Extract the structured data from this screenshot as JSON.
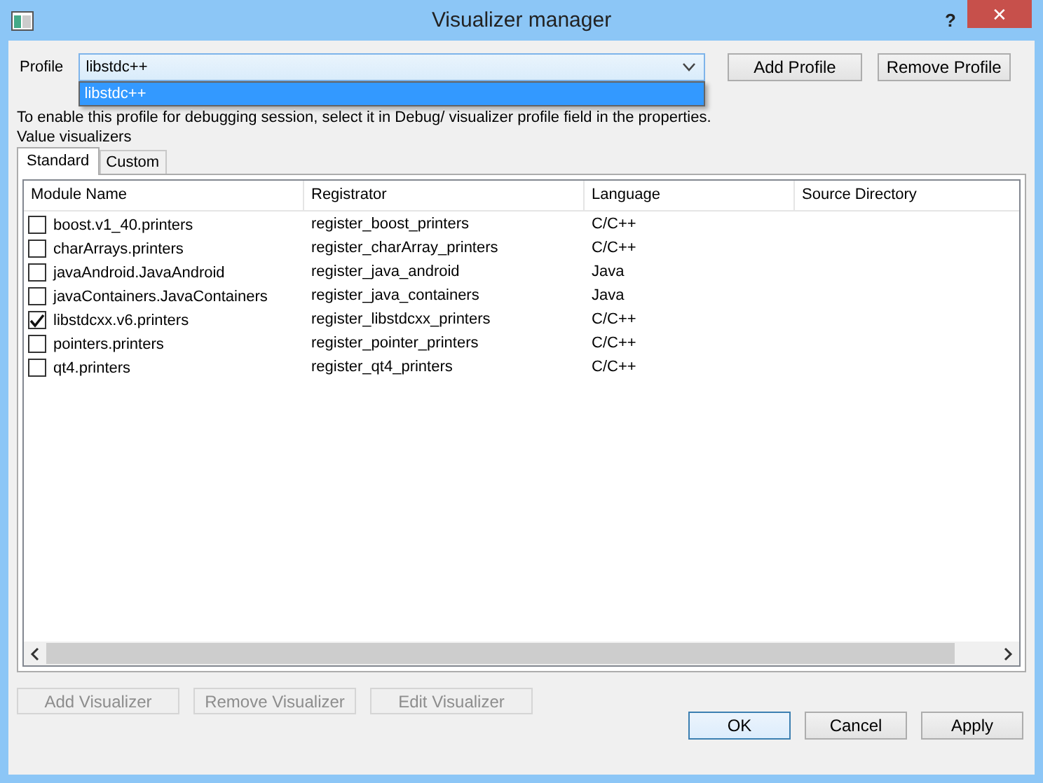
{
  "window": {
    "title": "Visualizer manager",
    "help": "?",
    "close": "✕"
  },
  "profile": {
    "label": "Profile",
    "value": "libstdc++",
    "dropdown_open": true,
    "options": [
      {
        "label": "libstdc++",
        "selected": true
      }
    ]
  },
  "profile_buttons": [
    {
      "label": "Add Profile",
      "disabled": false
    },
    {
      "label": "Remove Profile",
      "disabled": false
    }
  ],
  "info": "To enable this profile for debugging session, select it in Debug/ visualizer profile field in the properties.",
  "section_label": "Value visualizers",
  "tabs": [
    {
      "label": "Standard",
      "selected": true
    },
    {
      "label": "Custom",
      "selected": false
    }
  ],
  "table": {
    "columns": [
      "Module Name",
      "Registrator",
      "Language",
      "Source Directory"
    ],
    "rows": [
      {
        "checked": false,
        "cells": [
          "boost.v1_40.printers",
          "register_boost_printers",
          "C/C++"
        ]
      },
      {
        "checked": false,
        "cells": [
          "charArrays.printers",
          "register_charArray_printers",
          "C/C++"
        ]
      },
      {
        "checked": false,
        "cells": [
          "javaAndroid.JavaAndroid",
          "register_java_android",
          "Java"
        ]
      },
      {
        "checked": false,
        "cells": [
          "javaContainers.JavaContainers",
          "register_java_containers",
          "Java"
        ]
      },
      {
        "checked": true,
        "cells": [
          "libstdcxx.v6.printers",
          "register_libstdcxx_printers",
          "C/C++"
        ]
      },
      {
        "checked": false,
        "cells": [
          "pointers.printers",
          "register_pointer_printers",
          "C/C++"
        ]
      },
      {
        "checked": false,
        "cells": [
          "qt4.printers",
          "register_qt4_printers",
          "C/C++"
        ]
      }
    ]
  },
  "visualizer_buttons": [
    {
      "label": "Add Visualizer",
      "disabled": true
    },
    {
      "label": "Remove Visualizer",
      "disabled": true
    },
    {
      "label": "Edit Visualizer",
      "disabled": true
    }
  ],
  "dialog_buttons": [
    {
      "label": "OK",
      "default": true
    },
    {
      "label": "Cancel",
      "default": false
    },
    {
      "label": "Apply",
      "default": false
    }
  ]
}
